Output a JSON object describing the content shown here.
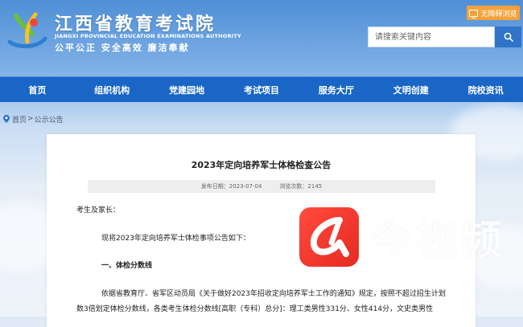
{
  "header": {
    "site_title": "江西省教育考试院",
    "site_title_en": "JIANGXI PROVINCIAL EDUCATION EXAMINATIONS AUTHORITY",
    "slogan": "公平公正  安全高效  廉洁奉献",
    "accessibility_label": "无障碍浏览",
    "search_placeholder": "请搜索关键内容"
  },
  "nav": {
    "items": [
      "首页",
      "组织机构",
      "党建园地",
      "考试项目",
      "服务大厅",
      "文明创建",
      "院校资讯"
    ]
  },
  "breadcrumb": {
    "home": "首页",
    "separator": ">",
    "current": "公示公告"
  },
  "article": {
    "title": "2023年定向培养军士体格检查公告",
    "publish_label": "发布日期：",
    "publish_date": "2023-07-04",
    "views_label": "浏览次数：",
    "views": "2145",
    "greeting": "考生及家长：",
    "intro": "现将2023年定向培养军士体检事项公告如下：",
    "section1_heading": "一、体检分数线",
    "para_line1": "依据省教育厅、省军区动员局《关于做好2023年招收定向培养军士工作的通知》规定，按照不超过招生计划",
    "para_line2": "数3倍划定体检分数线，各类考生体检分数线[高职（专科）总分]：理工类男性331分、女性414分，文史类男性"
  },
  "watermark": {
    "text": "今视频"
  },
  "colors": {
    "nav_bg": "#1a66c6",
    "accent_orange": "#f3a23a",
    "search_btn": "#2f74c8",
    "watermark_red": "#e62a21"
  }
}
